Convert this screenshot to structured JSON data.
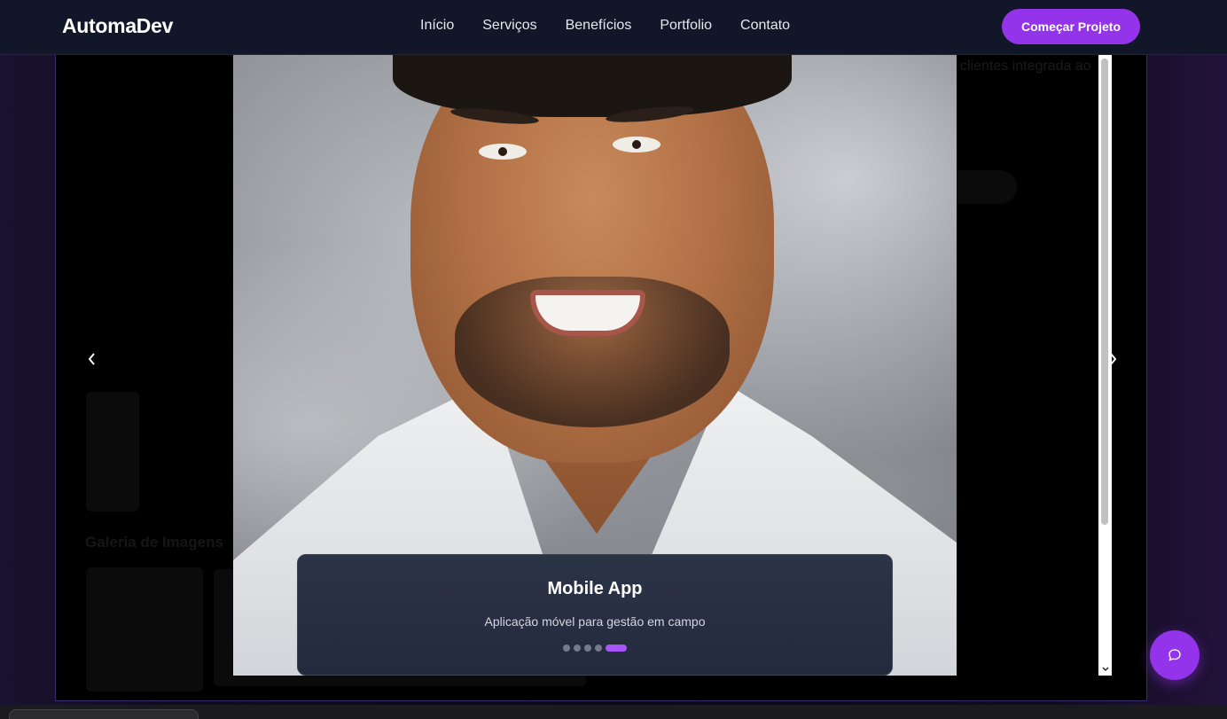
{
  "header": {
    "logo": "AutomaDev",
    "nav": [
      "Início",
      "Serviços",
      "Benefícios",
      "Portfolio",
      "Contato"
    ],
    "cta_label": "Começar Projeto"
  },
  "background": {
    "ghost_text": "Galeria de Imagens",
    "ghost_text_top": "clientes integrada ao"
  },
  "modal": {
    "prev_icon": "chevron-left-icon",
    "next_icon": "chevron-right-icon",
    "slide": {
      "title": "Mobile App",
      "description": "Aplicação móvel para gestão em campo",
      "total_slides": 5,
      "active_index": 4
    }
  },
  "chat": {
    "icon": "chat-bubble-icon"
  },
  "colors": {
    "accent": "#9333ea",
    "dot_active": "#a855f7",
    "nav_bg": "#111728",
    "card_bg": "#2b3347"
  }
}
